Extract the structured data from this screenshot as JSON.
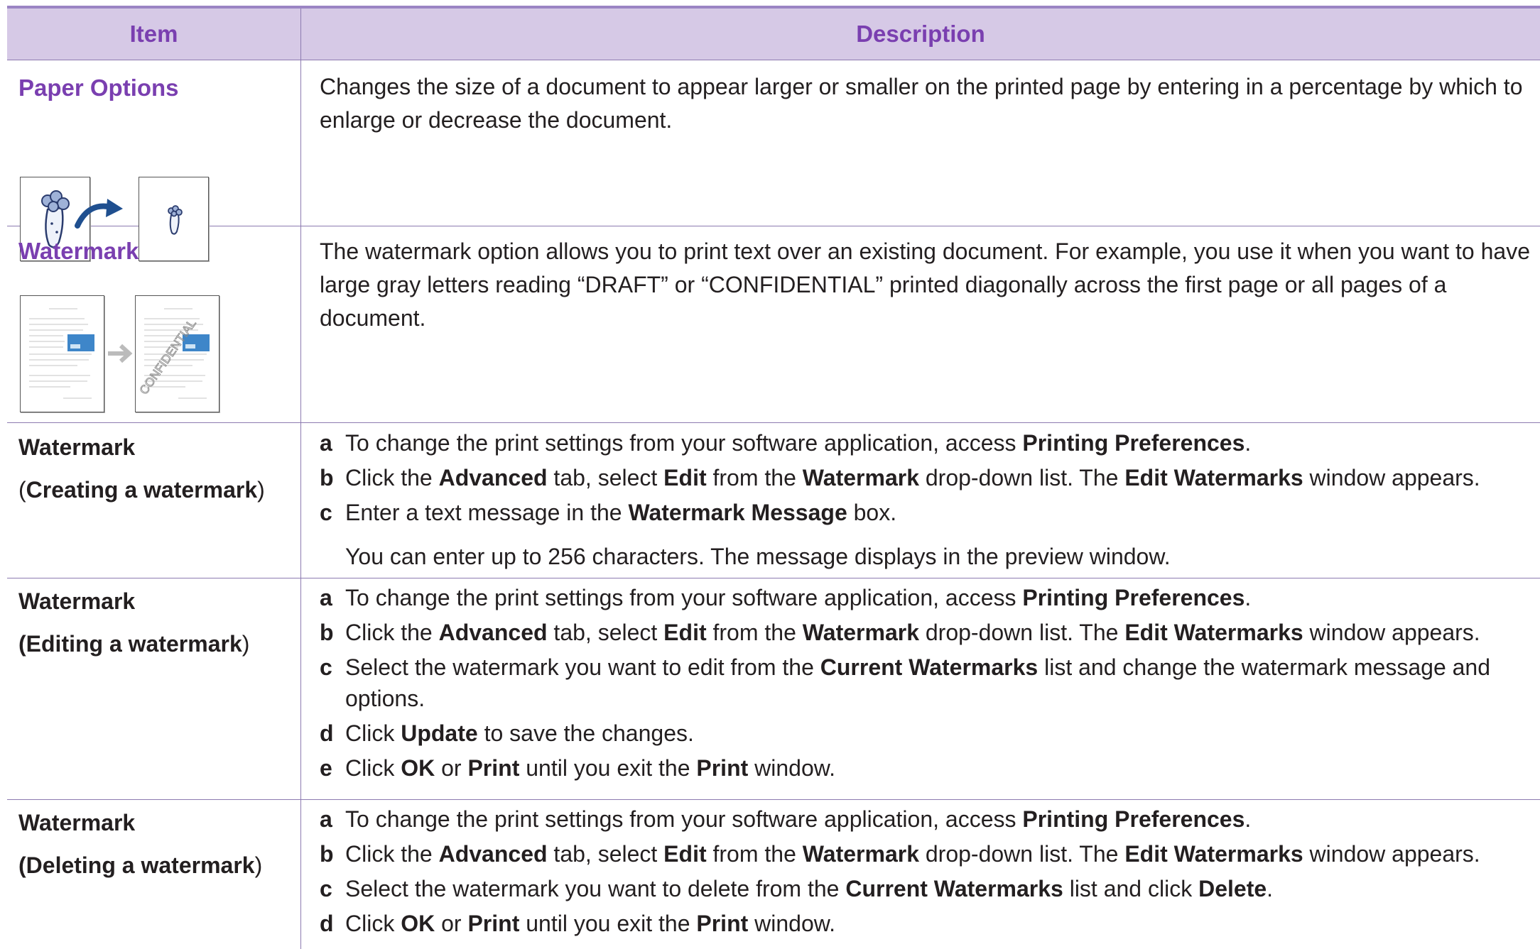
{
  "table": {
    "headers": {
      "item": "Item",
      "description": "Description"
    },
    "paper_options": {
      "title": "Paper Options",
      "description": "Changes the size of a document to appear larger or smaller on the printed page by entering in a percentage by which to enlarge or decrease the document."
    },
    "watermark": {
      "title": "Watermark",
      "description": "The watermark option allows you to print text over an existing document. For example, you use it when you want to have large gray letters reading “DRAFT” or “CONFIDENTIAL” printed diagonally across the first page or all pages of a document.",
      "thumb_stamp": "CONFIDENTIAL"
    },
    "creating": {
      "title": "Watermark",
      "subtitle": "Creating a watermark",
      "steps": [
        {
          "letter": "a",
          "parts": [
            "To change the print settings from your software application, access ",
            "Printing Preferences",
            "."
          ]
        },
        {
          "letter": "b",
          "parts": [
            "Click the ",
            "Advanced",
            " tab, select ",
            "Edit",
            " from the ",
            "Watermark",
            " drop-down list. The ",
            "Edit Watermarks",
            " window appears."
          ]
        },
        {
          "letter": "c",
          "parts": [
            "Enter a text message in the ",
            "Watermark Message",
            " box."
          ]
        }
      ],
      "note": "You can enter up to 256 characters. The message displays in the preview window."
    },
    "editing": {
      "title": "Watermark",
      "subtitle": "Editing a watermark",
      "steps": [
        {
          "letter": "a",
          "parts": [
            "To change the print settings from your software application, access ",
            "Printing Preferences",
            "."
          ]
        },
        {
          "letter": "b",
          "parts": [
            "Click the ",
            "Advanced",
            " tab, select ",
            "Edit",
            " from the ",
            "Watermark",
            " drop-down list. The ",
            "Edit Watermarks",
            " window appears."
          ]
        },
        {
          "letter": "c",
          "parts": [
            "Select the watermark you want to edit from the ",
            "Current Watermarks",
            " list and change the watermark message and options."
          ]
        },
        {
          "letter": "d",
          "parts": [
            "Click ",
            "Update",
            " to save the changes."
          ]
        },
        {
          "letter": "e",
          "parts": [
            "Click ",
            "OK",
            " or ",
            "Print",
            " until you exit the ",
            "Print",
            " window."
          ]
        }
      ]
    },
    "deleting": {
      "title": "Watermark",
      "subtitle": "Deleting a watermark",
      "steps": [
        {
          "letter": "a",
          "parts": [
            "To change the print settings from your software application, access ",
            "Printing Preferences",
            "."
          ]
        },
        {
          "letter": "b",
          "parts": [
            "Click the ",
            "Advanced",
            " tab, select ",
            "Edit",
            " from the ",
            "Watermark",
            " drop-down list. The ",
            "Edit Watermarks",
            " window appears."
          ]
        },
        {
          "letter": "c",
          "parts": [
            "Select the watermark you want to delete from the ",
            "Current Watermarks",
            " list and click ",
            "Delete",
            "."
          ]
        },
        {
          "letter": "d",
          "parts": [
            "Click ",
            "OK",
            " or ",
            "Print",
            " until you exit the ",
            "Print",
            " window."
          ]
        }
      ]
    }
  },
  "colors": {
    "header_bg": "#d6c9e6",
    "accent": "#7a3fb0",
    "rule": "#9b85c4"
  }
}
